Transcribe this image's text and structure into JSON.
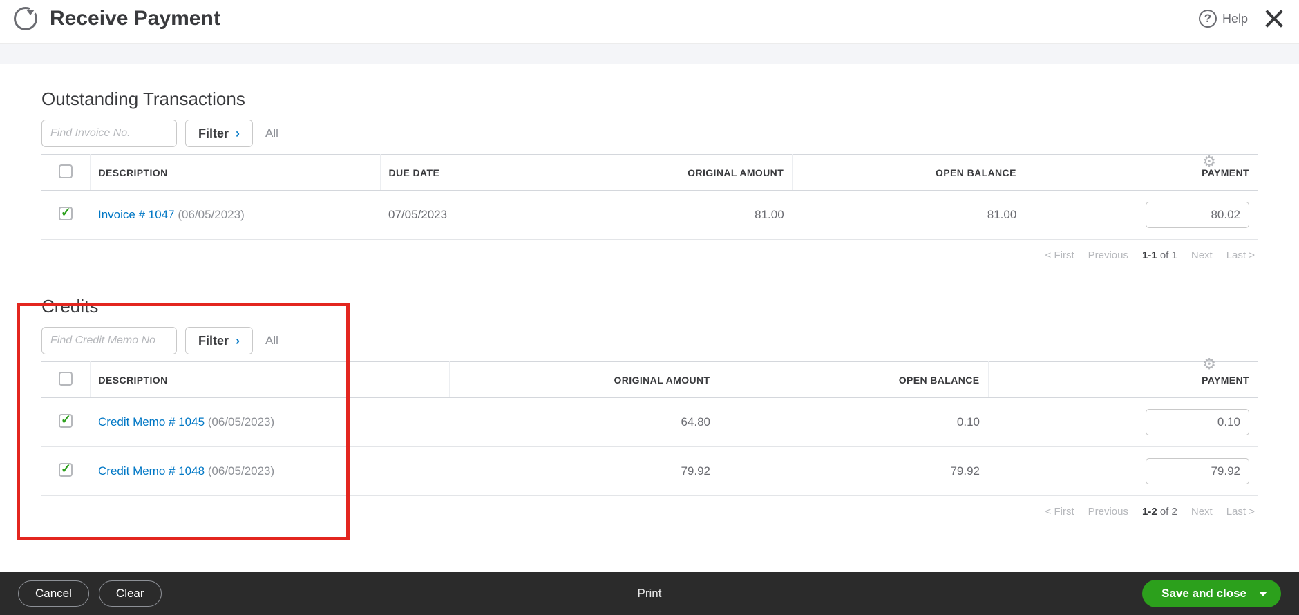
{
  "header": {
    "title": "Receive Payment",
    "help_label": "Help"
  },
  "outstanding": {
    "title": "Outstanding Transactions",
    "find_placeholder": "Find Invoice No.",
    "filter_label": "Filter",
    "filter_scope": "All",
    "columns": {
      "description": "DESCRIPTION",
      "due_date": "DUE DATE",
      "original_amount": "ORIGINAL AMOUNT",
      "open_balance": "OPEN BALANCE",
      "payment": "PAYMENT"
    },
    "rows": [
      {
        "checked": true,
        "link": "Invoice # 1047",
        "date": "(06/05/2023)",
        "due_date": "07/05/2023",
        "original_amount": "81.00",
        "open_balance": "81.00",
        "payment": "80.02"
      }
    ],
    "pager": {
      "first": "< First",
      "previous": "Previous",
      "range": "1-1",
      "of_total": "of 1",
      "next": "Next",
      "last": "Last >"
    }
  },
  "credits": {
    "title": "Credits",
    "find_placeholder": "Find Credit Memo No",
    "filter_label": "Filter",
    "filter_scope": "All",
    "columns": {
      "description": "DESCRIPTION",
      "original_amount": "ORIGINAL AMOUNT",
      "open_balance": "OPEN BALANCE",
      "payment": "PAYMENT"
    },
    "rows": [
      {
        "checked": true,
        "link": "Credit Memo # 1045",
        "date": "(06/05/2023)",
        "original_amount": "64.80",
        "open_balance": "0.10",
        "payment": "0.10"
      },
      {
        "checked": true,
        "link": "Credit Memo # 1048",
        "date": "(06/05/2023)",
        "original_amount": "79.92",
        "open_balance": "79.92",
        "payment": "79.92"
      }
    ],
    "pager": {
      "first": "< First",
      "previous": "Previous",
      "range": "1-2",
      "of_total": "of 2",
      "next": "Next",
      "last": "Last >"
    }
  },
  "footer": {
    "cancel": "Cancel",
    "clear": "Clear",
    "print": "Print",
    "save": "Save and close"
  }
}
